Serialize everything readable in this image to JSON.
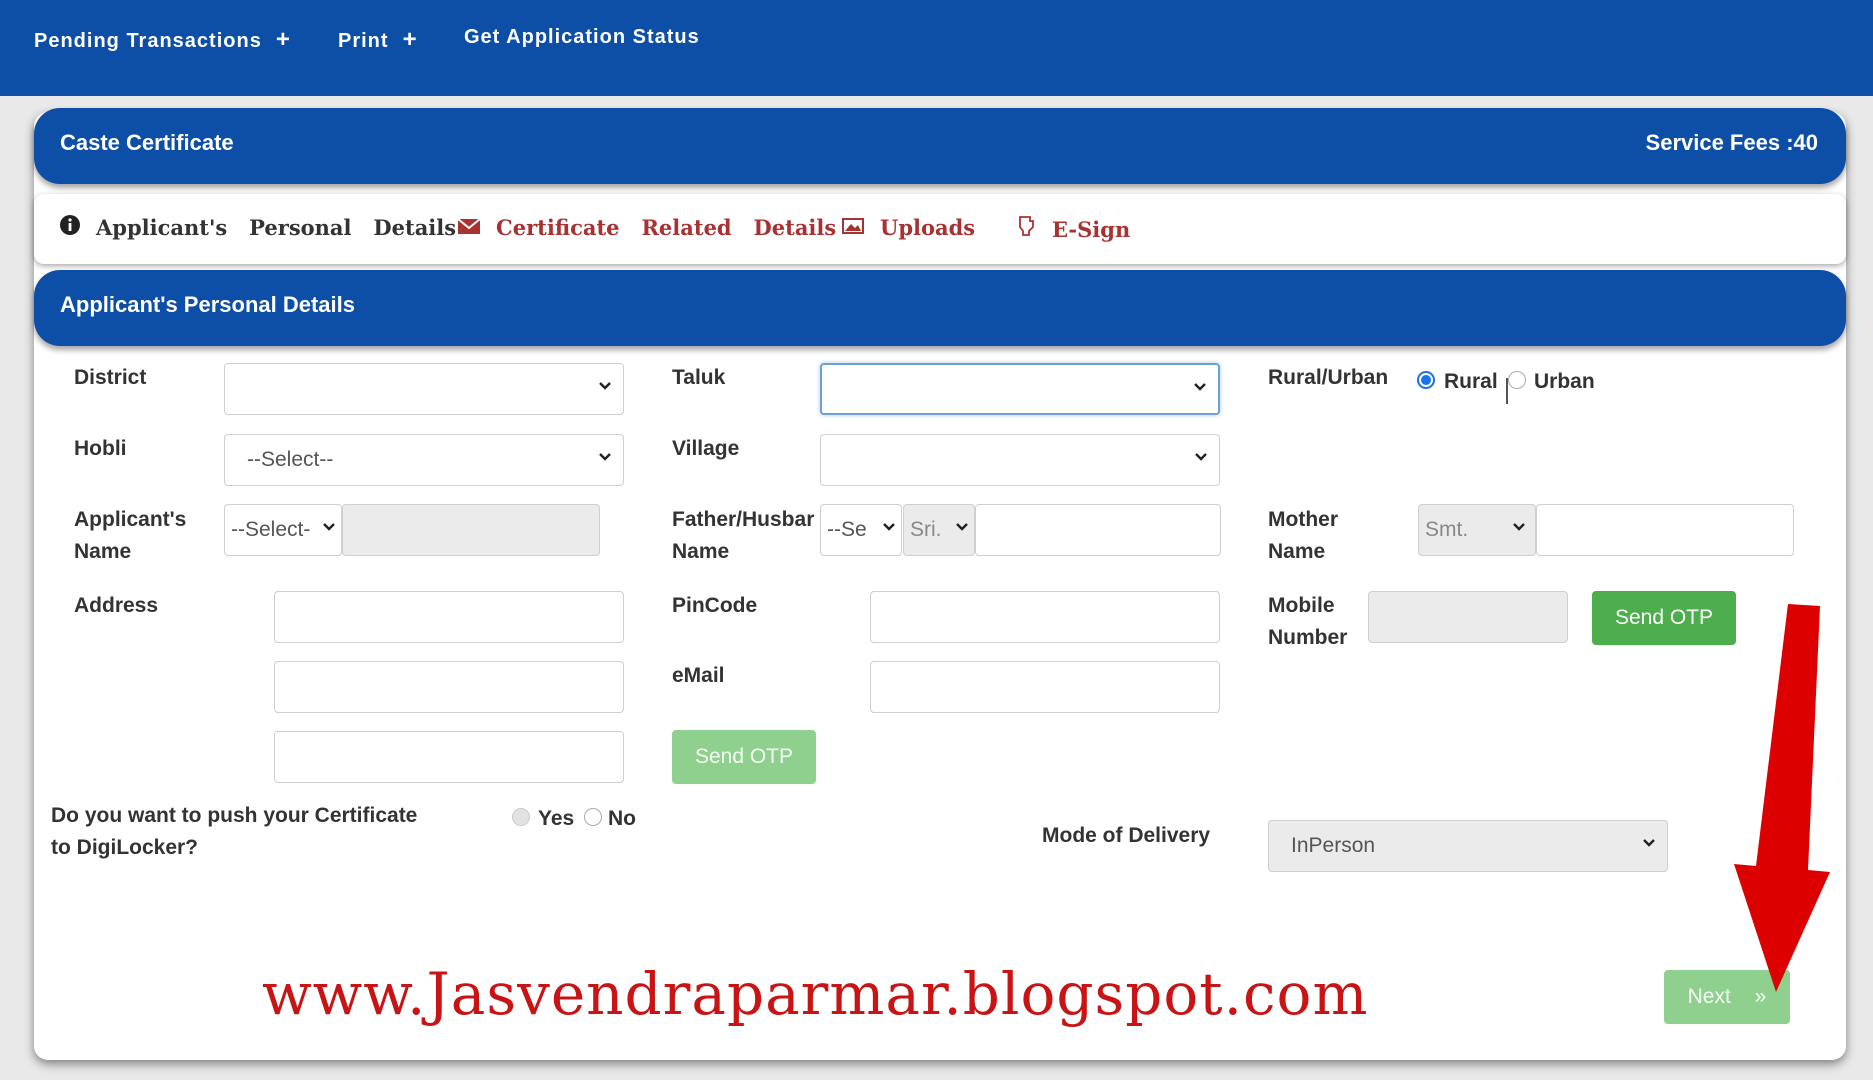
{
  "nav": {
    "items": [
      "Pending Transactions",
      "Print",
      "Get Application Status"
    ],
    "plus": "+"
  },
  "header": {
    "title": "Caste Certificate",
    "fees": "Service Fees :40"
  },
  "tabs": [
    {
      "icon": "info-icon",
      "label": "Applicant's   Personal   Details"
    },
    {
      "icon": "envelope-icon",
      "label": "Certificate   Related   Details"
    },
    {
      "icon": "image-icon",
      "label": "Uploads"
    },
    {
      "icon": "hand-icon",
      "label": "E-Sign"
    }
  ],
  "section": {
    "title": "Applicant's Personal Details"
  },
  "form": {
    "district_label": "District",
    "district_value": "",
    "taluk_label": "Taluk",
    "taluk_value": "",
    "rural_urban_label": "Rural/Urban",
    "rural_label": "Rural",
    "urban_label": "Urban",
    "hobli_label": "Hobli",
    "hobli_value": "--Select--",
    "village_label": "Village",
    "village_value": "",
    "applicant_label_1": "Applicant's",
    "applicant_label_2": "Name",
    "applicant_title": "--Select-",
    "father_label_1": "Father/Husbar",
    "father_label_2": "Name",
    "father_select": "--Se",
    "father_title": "Sri.",
    "mother_label_1": "Mother",
    "mother_label_2": "Name",
    "mother_title": "Smt.",
    "address_label": "Address",
    "pincode_label": "PinCode",
    "email_label": "eMail",
    "mobile_label_1": "Mobile",
    "mobile_label_2": "Number",
    "send_otp_mobile": "Send OTP",
    "send_otp_email": "Send OTP",
    "digilocker_q_1": "Do you want to push your Certificate",
    "digilocker_q_2": "to DigiLocker?",
    "yes_label": "Yes",
    "no_label": "No",
    "delivery_label": "Mode of Delivery",
    "delivery_value": "InPerson",
    "next_label": "Next",
    "next_arrow": "»"
  },
  "watermark": "www.Jasvendraparmar.blogspot.com",
  "colors": {
    "nav": "#0d4ea6",
    "button": "#4cae4c",
    "tab_link": "#a83232",
    "arrow": "#dd0000"
  }
}
